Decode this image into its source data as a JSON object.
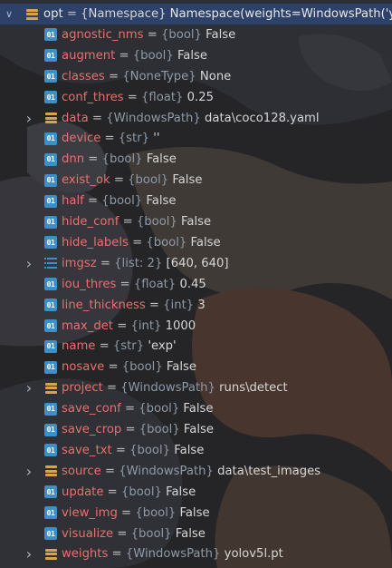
{
  "tree": {
    "root": {
      "name": "opt",
      "type": "{Namespace}",
      "value": "Namespace(weights=WindowsPath('y",
      "expanded": true
    },
    "items": [
      {
        "name": "agnostic_nms",
        "type": "{bool}",
        "value": "False",
        "icon": "primitive-icon",
        "expandable": false
      },
      {
        "name": "augment",
        "type": "{bool}",
        "value": "False",
        "icon": "primitive-icon",
        "expandable": false
      },
      {
        "name": "classes",
        "type": "{NoneType}",
        "value": "None",
        "icon": "primitive-icon",
        "expandable": false
      },
      {
        "name": "conf_thres",
        "type": "{float}",
        "value": "0.25",
        "icon": "primitive-icon",
        "expandable": false
      },
      {
        "name": "data",
        "type": "{WindowsPath}",
        "value": "data\\coco128.yaml",
        "icon": "object-icon",
        "expandable": true
      },
      {
        "name": "device",
        "type": "{str}",
        "value": "''",
        "icon": "primitive-icon",
        "expandable": false
      },
      {
        "name": "dnn",
        "type": "{bool}",
        "value": "False",
        "icon": "primitive-icon",
        "expandable": false
      },
      {
        "name": "exist_ok",
        "type": "{bool}",
        "value": "False",
        "icon": "primitive-icon",
        "expandable": false
      },
      {
        "name": "half",
        "type": "{bool}",
        "value": "False",
        "icon": "primitive-icon",
        "expandable": false
      },
      {
        "name": "hide_conf",
        "type": "{bool}",
        "value": "False",
        "icon": "primitive-icon",
        "expandable": false
      },
      {
        "name": "hide_labels",
        "type": "{bool}",
        "value": "False",
        "icon": "primitive-icon",
        "expandable": false
      },
      {
        "name": "imgsz",
        "type": "{list: 2}",
        "value": "[640, 640]",
        "icon": "list-icon",
        "expandable": true
      },
      {
        "name": "iou_thres",
        "type": "{float}",
        "value": "0.45",
        "icon": "primitive-icon",
        "expandable": false
      },
      {
        "name": "line_thickness",
        "type": "{int}",
        "value": "3",
        "icon": "primitive-icon",
        "expandable": false
      },
      {
        "name": "max_det",
        "type": "{int}",
        "value": "1000",
        "icon": "primitive-icon",
        "expandable": false
      },
      {
        "name": "name",
        "type": "{str}",
        "value": "'exp'",
        "icon": "primitive-icon",
        "expandable": false
      },
      {
        "name": "nosave",
        "type": "{bool}",
        "value": "False",
        "icon": "primitive-icon",
        "expandable": false
      },
      {
        "name": "project",
        "type": "{WindowsPath}",
        "value": "runs\\detect",
        "icon": "object-icon",
        "expandable": true
      },
      {
        "name": "save_conf",
        "type": "{bool}",
        "value": "False",
        "icon": "primitive-icon",
        "expandable": false
      },
      {
        "name": "save_crop",
        "type": "{bool}",
        "value": "False",
        "icon": "primitive-icon",
        "expandable": false
      },
      {
        "name": "save_txt",
        "type": "{bool}",
        "value": "False",
        "icon": "primitive-icon",
        "expandable": false
      },
      {
        "name": "source",
        "type": "{WindowsPath}",
        "value": "data\\test_images",
        "icon": "object-icon",
        "expandable": true
      },
      {
        "name": "update",
        "type": "{bool}",
        "value": "False",
        "icon": "primitive-icon",
        "expandable": false
      },
      {
        "name": "view_img",
        "type": "{bool}",
        "value": "False",
        "icon": "primitive-icon",
        "expandable": false
      },
      {
        "name": "visualize",
        "type": "{bool}",
        "value": "False",
        "icon": "primitive-icon",
        "expandable": false
      },
      {
        "name": "weights",
        "type": "{WindowsPath}",
        "value": "yolov5l.pt",
        "icon": "object-icon",
        "expandable": true
      }
    ],
    "primitive_icon_text": "01",
    "eq": "="
  },
  "colors": {
    "background": "#2b2b2b",
    "selection": "#2e436e",
    "name": "#e86f6f",
    "type": "#8d9aa8",
    "value": "#d6d6d6",
    "primitive_icon": "#3d8fc7",
    "object_icon": "#d7a44a"
  }
}
